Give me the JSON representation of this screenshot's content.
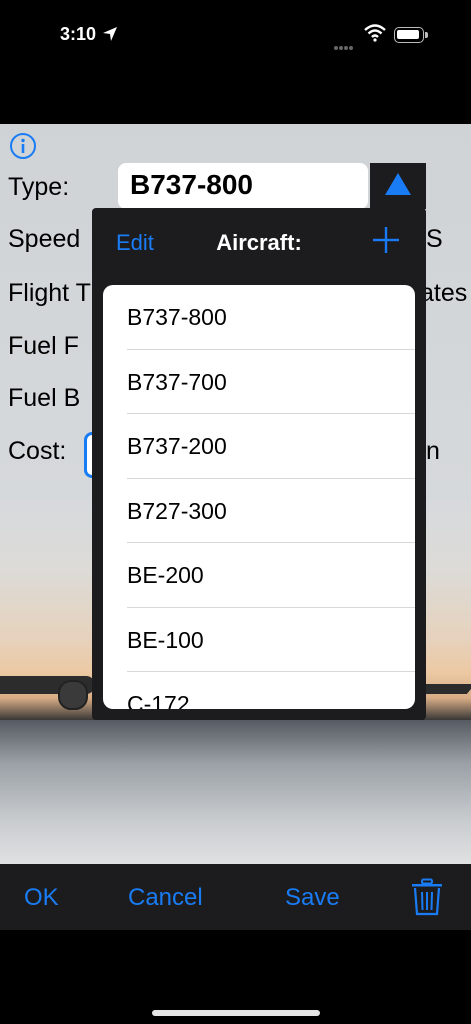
{
  "status": {
    "time": "3:10"
  },
  "form": {
    "type_label": "Type:",
    "type_value": "B737-800",
    "speed_label": "Speed",
    "speed_unit_partial": "S",
    "flight_label": "Flight T",
    "flight_unit_partial": "ates",
    "fuel_flow_label": "Fuel F",
    "fuel_burn_label": "Fuel B",
    "cost_label": "Cost:",
    "cost_unit_partial": "n"
  },
  "popover": {
    "edit_label": "Edit",
    "title": "Aircraft:",
    "items": [
      "B737-800",
      "B737-700",
      "B737-200",
      "B727-300",
      "BE-200",
      "BE-100",
      "C-172"
    ]
  },
  "toolbar": {
    "ok_label": "OK",
    "cancel_label": "Cancel",
    "save_label": "Save"
  },
  "colors": {
    "accent": "#1a7cf5",
    "panel": "#1c1c1e"
  }
}
